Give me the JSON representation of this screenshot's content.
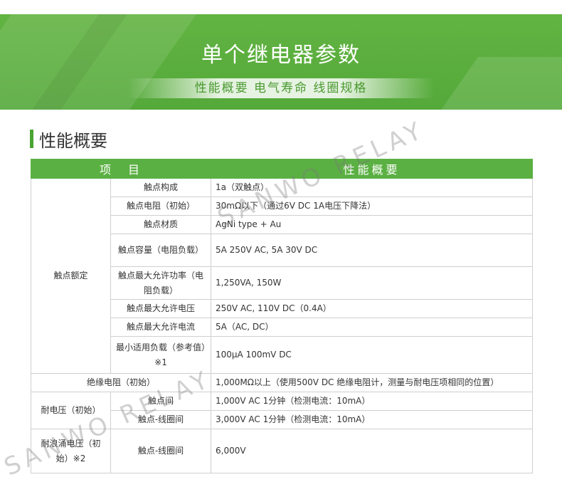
{
  "banner": {
    "title": "单个继电器参数",
    "subtitle": "性能概要 电气寿命 线圈规格"
  },
  "section": {
    "title": "性能概要"
  },
  "table": {
    "headers": [
      "项　目",
      "性能概要"
    ],
    "groups": {
      "contact_rating": "触点额定",
      "insulation": "绝缘电阻（初始）",
      "withstand": "耐电压（初始）",
      "surge": "耐浪涌电压（初始）※2"
    },
    "rows": [
      {
        "item": "触点构成",
        "value": "1a（双触点）"
      },
      {
        "item": "触点电阻（初始）",
        "value": "30mΩ以下（通过6V DC 1A电压下降法）"
      },
      {
        "item": "触点材质",
        "value": "AgNi type + Au"
      },
      {
        "item": "触点容量（电阻负载）",
        "value": "5A 250V AC, 5A 30V DC"
      },
      {
        "item": "触点最大允许功率（电阻负载）",
        "value": "1,250VA, 150W"
      },
      {
        "item": "触点最大允许电压",
        "value": "250V AC, 110V DC（0.4A）"
      },
      {
        "item": "触点最大允许电流",
        "value": "5A（AC, DC）"
      },
      {
        "item": "最小适用负载（参考值）※1",
        "value": "100μA 100mV DC"
      },
      {
        "item": "",
        "value": "1,000MΩ以上（使用500V DC 绝缘电阻计，测量与耐电压项相同的位置）"
      },
      {
        "item": "触点间",
        "value": "1,000V AC 1分钟（检测电流：10mA）"
      },
      {
        "item": "触点-线圈间",
        "value": "3,000V AC 1分钟（检测电流：10mA）"
      },
      {
        "item": "触点-线圈间",
        "value": "6,000V"
      }
    ]
  },
  "watermark": "SANWO RELAY",
  "colors": {
    "green": "#5bb043",
    "banner": "#58ad3c"
  }
}
